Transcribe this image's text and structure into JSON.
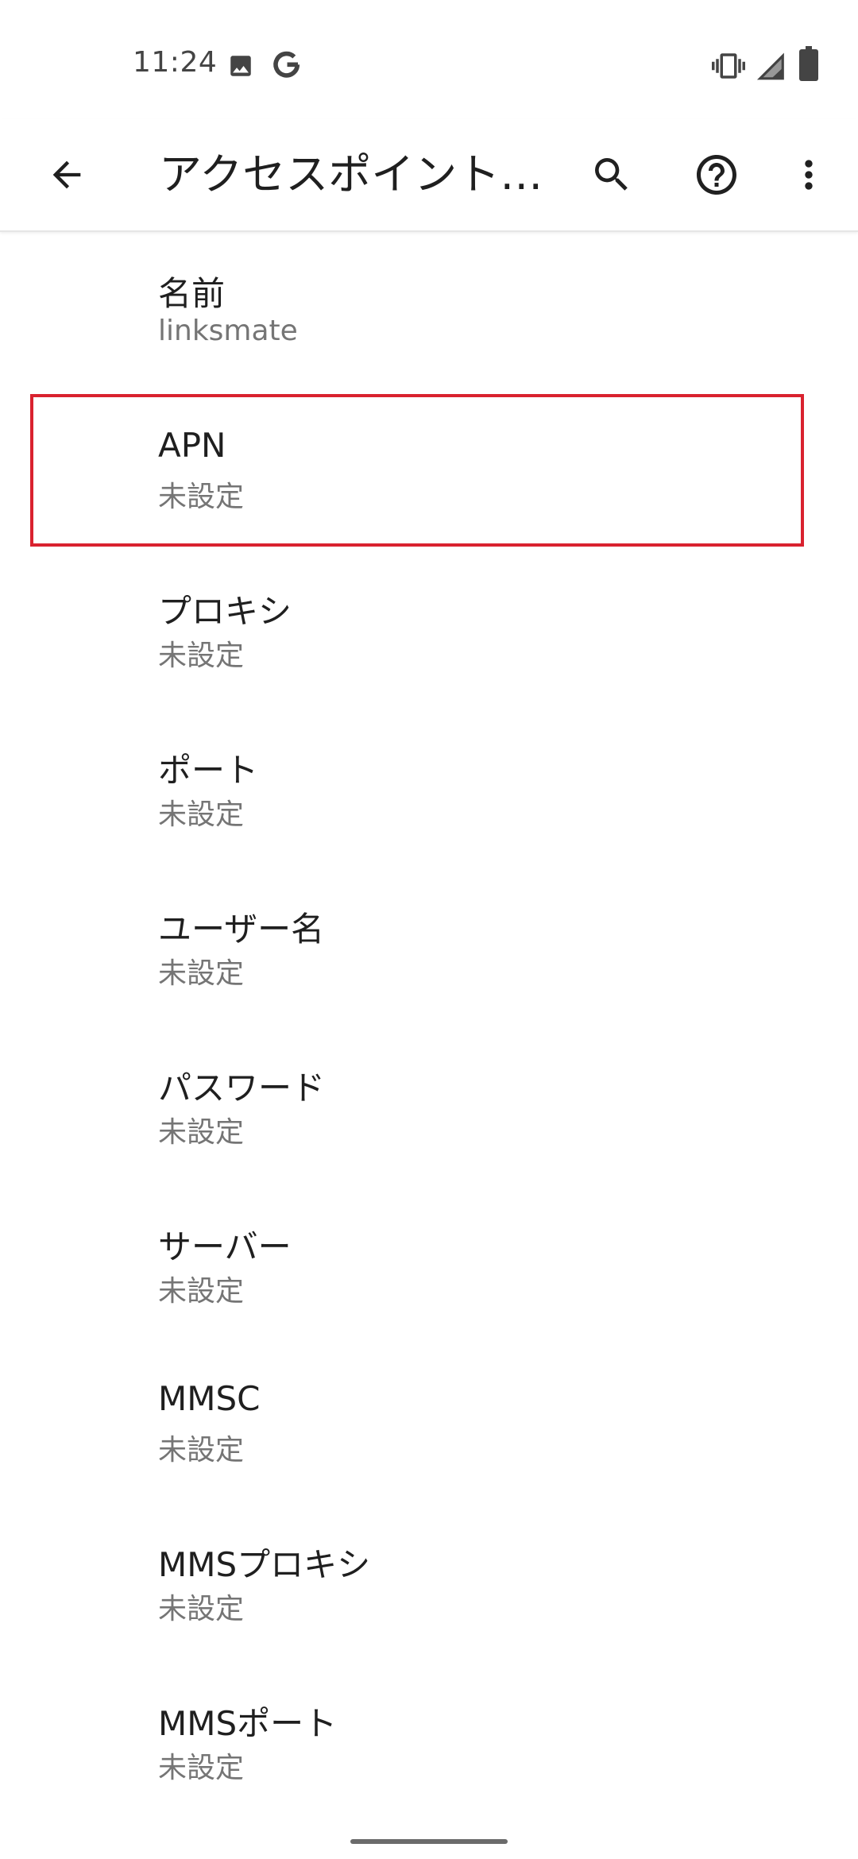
{
  "status_bar": {
    "time": "11:24",
    "icons": [
      "image-icon",
      "google-g-icon",
      "vibrate-icon",
      "signal-icon",
      "battery-icon"
    ]
  },
  "app_bar": {
    "title": "アクセスポイント…",
    "back_icon": "arrow-back-icon",
    "actions": [
      "search-icon",
      "help-icon",
      "more-vert-icon"
    ]
  },
  "apn_fields": [
    {
      "label": "名前",
      "value": "linksmate"
    },
    {
      "label": "APN",
      "value": "未設定"
    },
    {
      "label": "プロキシ",
      "value": "未設定"
    },
    {
      "label": "ポート",
      "value": "未設定"
    },
    {
      "label": "ユーザー名",
      "value": "未設定"
    },
    {
      "label": "パスワード",
      "value": "未設定"
    },
    {
      "label": "サーバー",
      "value": "未設定"
    },
    {
      "label": "MMSC",
      "value": "未設定"
    },
    {
      "label": "MMSプロキシ",
      "value": "未設定"
    },
    {
      "label": "MMSポート",
      "value": "未設定"
    }
  ],
  "highlight": {
    "color": "#d9222f",
    "target_index": 1
  },
  "colors": {
    "primary_text": "#1f1f1f",
    "secondary_text": "#757575",
    "background": "#ffffff"
  }
}
